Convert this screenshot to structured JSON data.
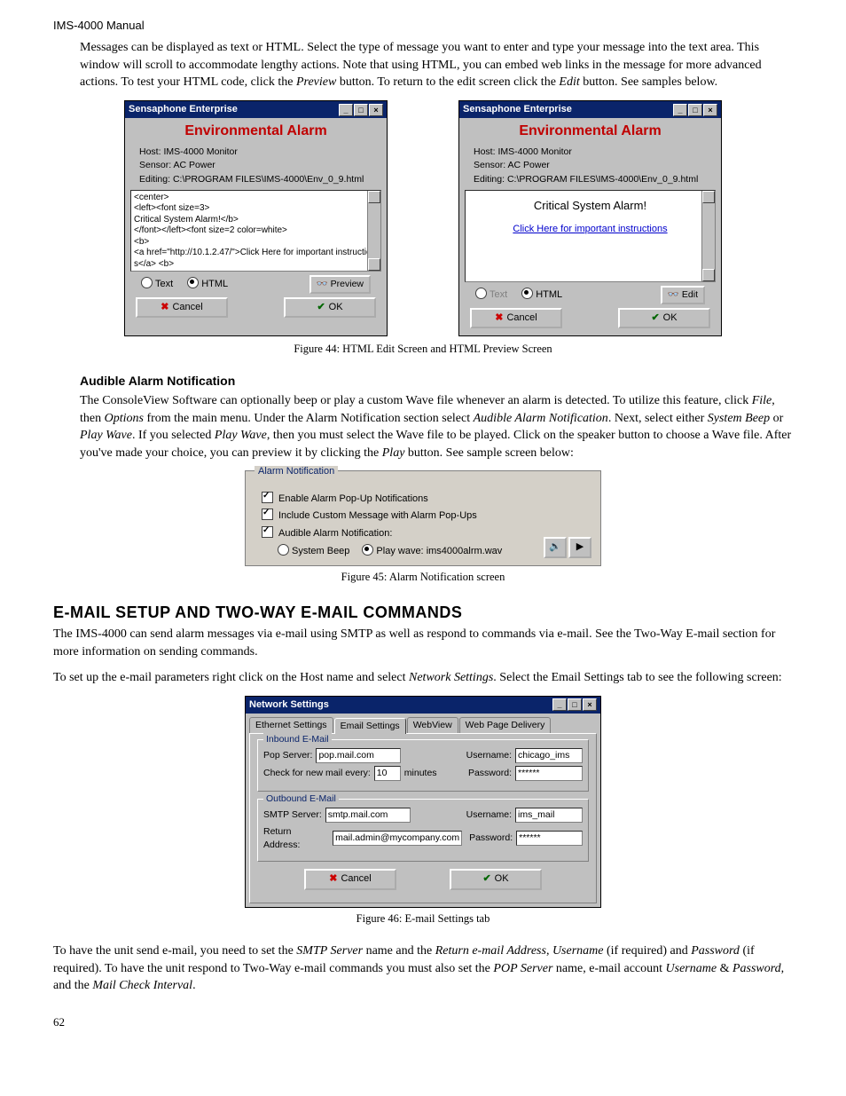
{
  "header": "IMS-4000 Manual",
  "intro_paragraph": "Messages can be displayed as text or HTML. Select the type of message you want to enter and type your message into the text area. This window will scroll to accommodate lengthy actions. Note that using HTML, you can embed web links in the message for more advanced actions. To test your HTML code, click the ",
  "intro_preview": "Preview",
  "intro_mid": " button. To return to the edit screen click the ",
  "intro_edit": "Edit",
  "intro_tail": " button. See samples below.",
  "fig44": {
    "left": {
      "title": "Sensaphone Enterprise",
      "heading": "Environmental Alarm",
      "host_label": "Host:",
      "host_value": "IMS-4000 Monitor",
      "sensor_label": "Sensor:",
      "sensor_value": "AC Power",
      "editing_label": "Editing:",
      "editing_value": "C:\\PROGRAM FILES\\IMS-4000\\Env_0_9.html",
      "textarea": "<center>\n<left><font size=3>\nCritical System Alarm!</b>\n</font></left><font size=2 color=white>\n<b>\n<a href=\"http://10.1.2.47/\">Click Here for important instructions</a> <b>",
      "radio_text": "Text",
      "radio_html": "HTML",
      "preview_btn": "Preview",
      "cancel_btn": "Cancel",
      "ok_btn": "OK"
    },
    "right": {
      "title": "Sensaphone Enterprise",
      "heading": "Environmental Alarm",
      "host_label": "Host:",
      "host_value": "IMS-4000 Monitor",
      "sensor_label": "Sensor:",
      "sensor_value": "AC Power",
      "editing_label": "Editing:",
      "editing_value": "C:\\PROGRAM FILES\\IMS-4000\\Env_0_9.html",
      "preview_big": "Critical System Alarm!",
      "preview_link": "Click Here for important instructions",
      "radio_text": "Text",
      "radio_html": "HTML",
      "edit_btn": "Edit",
      "cancel_btn": "Cancel",
      "ok_btn": "OK"
    },
    "caption": "Figure 44: HTML Edit Screen and HTML Preview Screen"
  },
  "audible": {
    "heading": "Audible Alarm Notification",
    "p1a": "The ConsoleView Software can optionally beep or play a custom Wave file whenever an alarm is detected. To utilize this feature, click ",
    "p1_file": "File",
    "p1b": ", then ",
    "p1_options": "Options",
    "p1c": " from the main menu. Under the Alarm Notification section select ",
    "p1_audible": "Audible Alarm Notification",
    "p1d": ". Next, select either ",
    "p1_sysbeep": "System Beep",
    "p1e": " or ",
    "p1_playwave": "Play Wave",
    "p1f": ". If you selected ",
    "p1_playwave2": "Play Wave",
    "p1g": ", then you must select the Wave file to be played. Click on the speaker button to choose a Wave file. After you've made your choice, you can preview it by clicking the ",
    "p1_play": "Play",
    "p1h": " button. See sample screen below:"
  },
  "fig45": {
    "legend": "Alarm Notification",
    "chk1": "Enable Alarm Pop-Up Notifications",
    "chk2": "Include Custom Message with Alarm Pop-Ups",
    "chk3": "Audible Alarm Notification:",
    "radio_sysbeep": "System Beep",
    "radio_playwave": "Play wave:",
    "wave_file": "ims4000alrm.wav",
    "caption": "Figure 45: Alarm Notification screen"
  },
  "email_section": {
    "heading": "E-mail Setup and Two-Way E-mail Commands",
    "p1": "The IMS-4000 can send alarm messages via e-mail using SMTP as well as respond to commands via e-mail. See the Two-Way E-mail section for more information on sending commands.",
    "p2a": "To set up the e-mail parameters right click on the Host name and select ",
    "p2_netset": "Network Settings",
    "p2b": ". Select the Email Settings tab to see the following screen:"
  },
  "fig46": {
    "title": "Network Settings",
    "tabs": [
      "Ethernet Settings",
      "Email Settings",
      "WebView",
      "Web Page Delivery"
    ],
    "inbound": {
      "legend": "Inbound E-Mail",
      "pop_label": "Pop Server:",
      "pop_value": "pop.mail.com",
      "user_label": "Username:",
      "user_value": "chicago_ims",
      "check_label": "Check for new mail every:",
      "check_value": "10",
      "check_unit": "minutes",
      "pass_label": "Password:",
      "pass_value": "******"
    },
    "outbound": {
      "legend": "Outbound E-Mail",
      "smtp_label": "SMTP Server:",
      "smtp_value": "smtp.mail.com",
      "user_label": "Username:",
      "user_value": "ims_mail",
      "return_label": "Return Address:",
      "return_value": "mail.admin@mycompany.com",
      "pass_label": "Password:",
      "pass_value": "******"
    },
    "cancel_btn": "Cancel",
    "ok_btn": "OK",
    "caption": "Figure 46: E-mail Settings tab"
  },
  "final_para": {
    "a": "To have the unit send e-mail, you need to set the ",
    "smtp": "SMTP Server",
    "b": " name and the ",
    "return": "Return e-mail Address",
    "c": ", ",
    "user": "Username",
    "d": " (if required) and ",
    "pass": "Password",
    "e": " (if required). To have the unit respond to Two-Way e-mail commands you must also set the ",
    "pop": "POP Server",
    "f": " name, e-mail account ",
    "user2": "Username",
    "g": " & ",
    "pass2": "Password",
    "h": ", and the ",
    "interval": "Mail Check Interval",
    "i": "."
  },
  "page_number": "62"
}
